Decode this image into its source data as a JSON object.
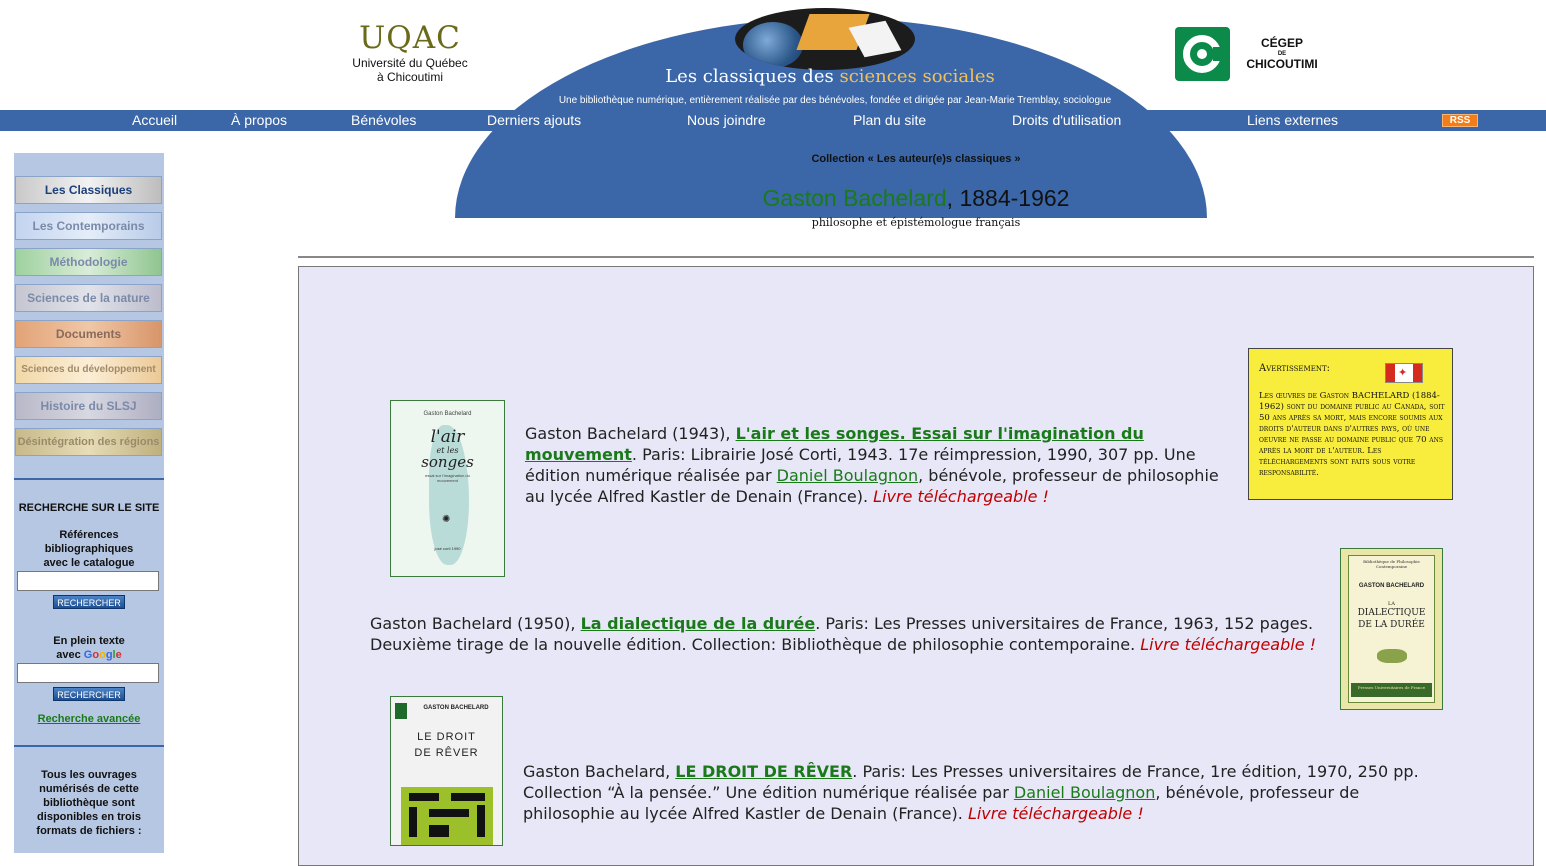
{
  "header": {
    "uqac_abbr": "UQAC",
    "uqac_line1": "Université du Québec",
    "uqac_line2": "à Chicoutimi",
    "site_title_plain": "Les classiques des ",
    "site_title_accent": "sciences sociales",
    "tagline": "Une bibliothèque numérique, entièrement réalisée par des bénévoles, fondée et dirigée par Jean-Marie Tremblay, sociologue",
    "cegep_line1": "CÉGEP",
    "cegep_line2": "DE",
    "cegep_line3": "CHICOUTIMI"
  },
  "nav": {
    "items": [
      "Accueil",
      "À propos",
      "Bénévoles",
      "Derniers ajouts",
      "Nous joindre",
      "Plan du site",
      "Droits d'utilisation",
      "Liens externes"
    ],
    "rss": "RSS"
  },
  "sidebar": {
    "buttons": [
      "Les Classiques",
      "Les Contemporains",
      "Méthodologie",
      "Sciences de la nature",
      "Documents",
      "Sciences du développement",
      "Histoire du SLSJ",
      "Désintégration des régions"
    ],
    "search_heading": "RECHERCHE SUR LE SITE",
    "catalog_l1": "Références",
    "catalog_l2": "bibliographiques",
    "catalog_l3": "avec le catalogue",
    "search_button": "RECHERCHER",
    "fulltext_l1": "En plein texte",
    "fulltext_l2": "avec ",
    "google_letters": [
      "G",
      "o",
      "o",
      "g",
      "l",
      "e"
    ],
    "advanced_search": "Recherche avancée",
    "formats_l1": "Tous les ouvrages",
    "formats_l2": "numérisés de cette",
    "formats_l3": "bibliothèque sont",
    "formats_l4": "disponibles en trois",
    "formats_l5": "formats de fichiers :"
  },
  "main": {
    "breadcrumb": "Collection « Les auteur(e)s classiques »",
    "author_name": "Gaston Bachelard",
    "author_dates": ", 1884-1962",
    "author_desc": "philosophe et épistémologue français"
  },
  "warning": {
    "heading": "Avertissement:",
    "text": "Les œuvres de Gaston BACHELARD (1884-1962) sont du domaine public au Canada, soit 50 ans après sa mort, mais encore soumis aux droits d'auteur dans d'autres pays, où une oeuvre ne passe au domaine public que 70 ans après la mort de l'auteur. Les téléchargements sont faits sous votre responsabilité."
  },
  "books": [
    {
      "before": "Gaston Bachelard (1943), ",
      "title": "L'air et les songes. Essai sur l'imagination du mouvement",
      "after": ". Paris: Librairie José Corti, 1943. 17e réimpression, 1990, 307 pp. Une édition numérique réalisée par ",
      "person": "Daniel Boulagnon",
      "after2": ", bénévole, professeur de philosophie au lycée Alfred Kastler de Denain (France). ",
      "download": "Livre téléchargeable !",
      "cover_author": "Gaston Bachelard",
      "cover_title1": "l'air",
      "cover_title2": "et les",
      "cover_title3": "songes",
      "cover_sub": "essai sur l'imagination du mouvement",
      "cover_pub": "josé corti 1990"
    },
    {
      "before": "Gaston Bachelard (1950), ",
      "title": "La dialectique de la durée",
      "after": ". Paris: Les Presses universitaires de France, 1963, 152 pages. Deuxième tirage de la nouvelle édition. Collection: Bibliothèque de philosophie contemporaine. ",
      "download": "Livre téléchargeable !",
      "cover_series": "Bibliothèque de Philosophie Contemporaine",
      "cover_author": "GASTON BACHELARD",
      "cover_la": "LA",
      "cover_title1": "DIALECTIQUE",
      "cover_title2": "DE LA DURÉE",
      "cover_pub": "Presses Universitaires de France"
    },
    {
      "before": "Gaston Bachelard, ",
      "title": "LE DROIT DE RÊVER",
      "after": ". Paris: Les Presses universitaires de France, 1re édition, 1970, 250 pp. Collection “À la pensée.” Une édition numérique réalisée par ",
      "person": "Daniel Boulagnon",
      "after2": ", bénévole, professeur de philosophie au lycée Alfred Kastler de Denain (France). ",
      "download": "Livre téléchargeable !",
      "cover_author": "GASTON BACHELARD",
      "cover_title1": "LE DROIT",
      "cover_title2": "DE RÊVER"
    }
  ],
  "colors": {
    "nav_blue": "#3b67a8",
    "link_green": "#1a7a1a",
    "download_red": "#c00000",
    "panel_bg": "#e7e7f7",
    "warning_yellow": "#f8ed3c"
  }
}
